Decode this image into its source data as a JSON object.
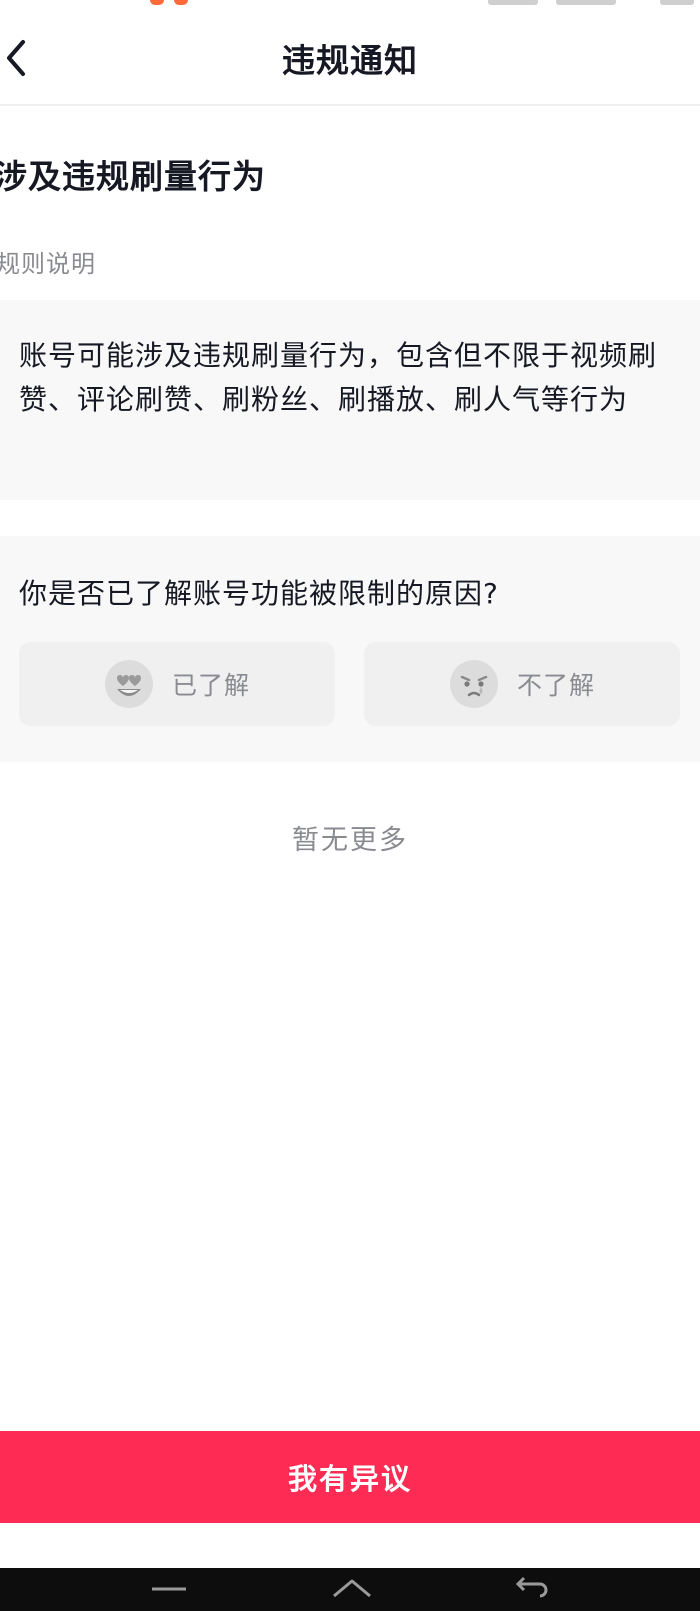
{
  "nav": {
    "title": "违规通知",
    "back_icon": "chevron-left-icon"
  },
  "rule": {
    "title": "涉及违规刷量行为",
    "subtitle": "规则说明",
    "description": "账号可能涉及违规刷量行为，包含但不限于视频刷赞、评论刷赞、刷粉丝、刷播放、刷人气等行为"
  },
  "question": {
    "text": "你是否已了解账号功能被限制的原因?",
    "options": [
      {
        "label": "已了解",
        "icon": "heart-eyes-emoji-icon"
      },
      {
        "label": "不了解",
        "icon": "crying-emoji-icon"
      }
    ]
  },
  "footer_note": "暂无更多",
  "appeal_button": {
    "label": "我有异议",
    "color": "#fe2c55"
  },
  "system_nav": {
    "icons": [
      "menu-icon",
      "home-icon",
      "back-icon"
    ]
  },
  "colors": {
    "accent": "#fe2c55",
    "card_bg": "#f8f8f8",
    "secondary_text": "#8a8b91"
  }
}
